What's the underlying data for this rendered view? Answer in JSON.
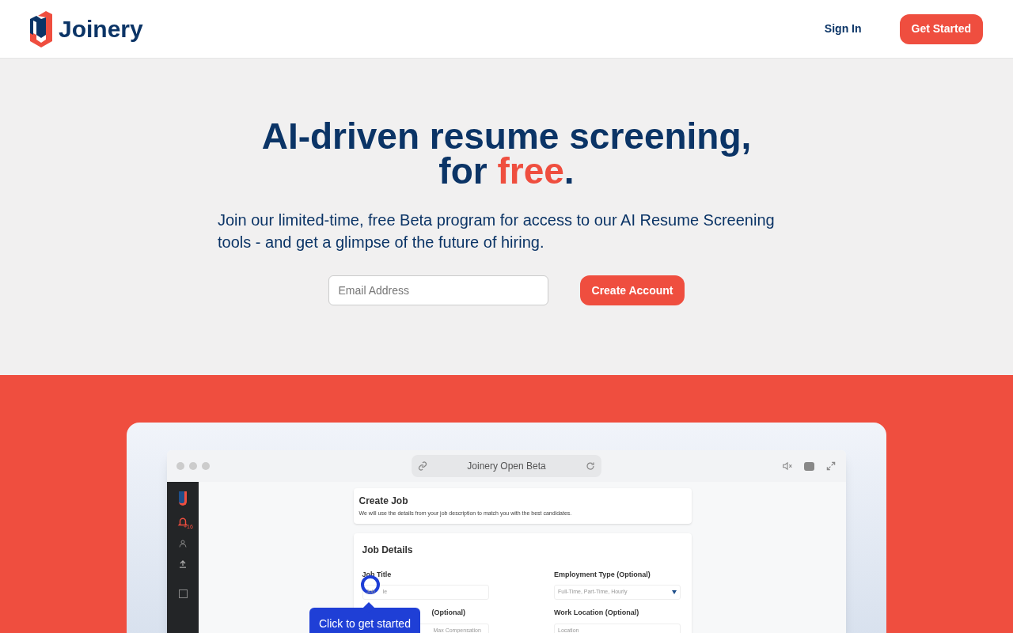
{
  "header": {
    "brand": "Joinery",
    "nav": [
      {
        "label": "Sign In",
        "kind": "link"
      },
      {
        "label": "Get Started",
        "kind": "button"
      }
    ]
  },
  "hero": {
    "title_line_1": "AI-driven resume screening,",
    "title_line_2": "for **free**.",
    "subtitle": "Join our limited-time, free Beta program for access to our AI Resume Screening tools - and get a glimpse of the future of hiring.",
    "email": {
      "placeholder": "Email Address"
    },
    "button": "Create Account"
  },
  "demo": {
    "address_bar": "Joinery Open Beta",
    "sidebar_badge": "+16",
    "create_job": {
      "title": "Create Job",
      "description": "We will use the details from your job description to match you with the best candidates."
    },
    "job_details": {
      "title": "Job Details",
      "fields": [
        {
          "label": "Job Title",
          "value_visible_start": "Job",
          "value_visible_end": "le"
        },
        {
          "label": "Employment Type (Optional)",
          "placeholder": "Full-Time, Part-Time, Hourly",
          "kind": "select"
        },
        {
          "label": "(Optional)",
          "placeholder": "Max Compensation",
          "kind": "partial"
        },
        {
          "label": "Work Location (Optional)",
          "placeholder": "Location"
        }
      ]
    },
    "tooltip": "Click to get started"
  }
}
